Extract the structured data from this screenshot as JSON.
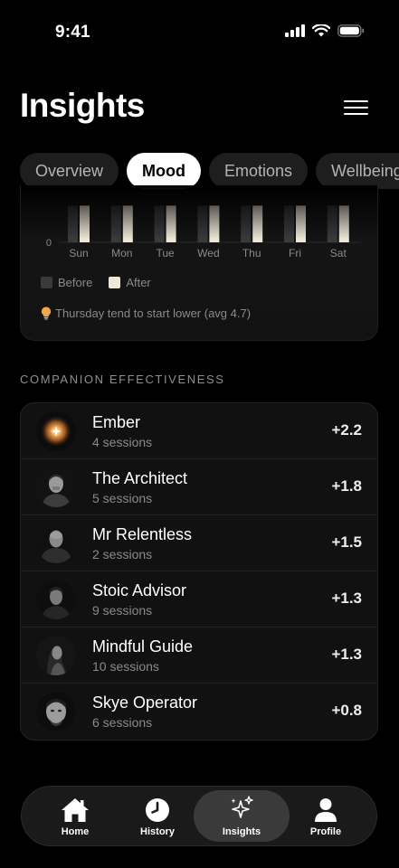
{
  "status_bar": {
    "time": "9:41"
  },
  "header": {
    "title": "Insights"
  },
  "tabs": [
    {
      "label": "Overview"
    },
    {
      "label": "Mood",
      "active": true
    },
    {
      "label": "Emotions"
    },
    {
      "label": "Wellbeing"
    }
  ],
  "chart_data": {
    "type": "bar",
    "categories": [
      "Sun",
      "Mon",
      "Tue",
      "Wed",
      "Thu",
      "Fri",
      "Sat"
    ],
    "series": [
      {
        "name": "Before",
        "values": [
          7,
          7,
          7,
          7,
          7,
          7,
          7
        ]
      },
      {
        "name": "After",
        "values": [
          7,
          7,
          7,
          7,
          7,
          7,
          7
        ]
      }
    ],
    "y_tick_labels": [
      "0"
    ],
    "ylim": [
      0,
      10
    ],
    "legend_placement": "bottom-left",
    "colors": {
      "before": "#3a3a3a",
      "after": "#efe7d8"
    }
  },
  "chart_card": {
    "legend": {
      "before": "Before",
      "after": "After"
    },
    "note_icon": "lightbulb-icon",
    "note": "Thursday tend to start lower (avg 4.7)"
  },
  "section": {
    "title": "COMPANION EFFECTIVENESS"
  },
  "companions": [
    {
      "name": "Ember",
      "sessions": "4 sessions",
      "score": "+2.2",
      "avatar": "ember-glow"
    },
    {
      "name": "The Architect",
      "sessions": "5 sessions",
      "score": "+1.8",
      "avatar": "portrait"
    },
    {
      "name": "Mr Relentless",
      "sessions": "2 sessions",
      "score": "+1.5",
      "avatar": "portrait"
    },
    {
      "name": "Stoic Advisor",
      "sessions": "9 sessions",
      "score": "+1.3",
      "avatar": "portrait"
    },
    {
      "name": "Mindful Guide",
      "sessions": "10 sessions",
      "score": "+1.3",
      "avatar": "portrait"
    },
    {
      "name": "Skye Operator",
      "sessions": "6 sessions",
      "score": "+0.8",
      "avatar": "portrait"
    }
  ],
  "nav": [
    {
      "label": "Home",
      "icon": "home-icon"
    },
    {
      "label": "History",
      "icon": "clock-icon"
    },
    {
      "label": "Insights",
      "icon": "sparkles-icon",
      "active": true
    },
    {
      "label": "Profile",
      "icon": "person-icon"
    }
  ],
  "colors": {
    "accent_after": "#efe7d8",
    "background": "#000000",
    "card": "#111111"
  }
}
